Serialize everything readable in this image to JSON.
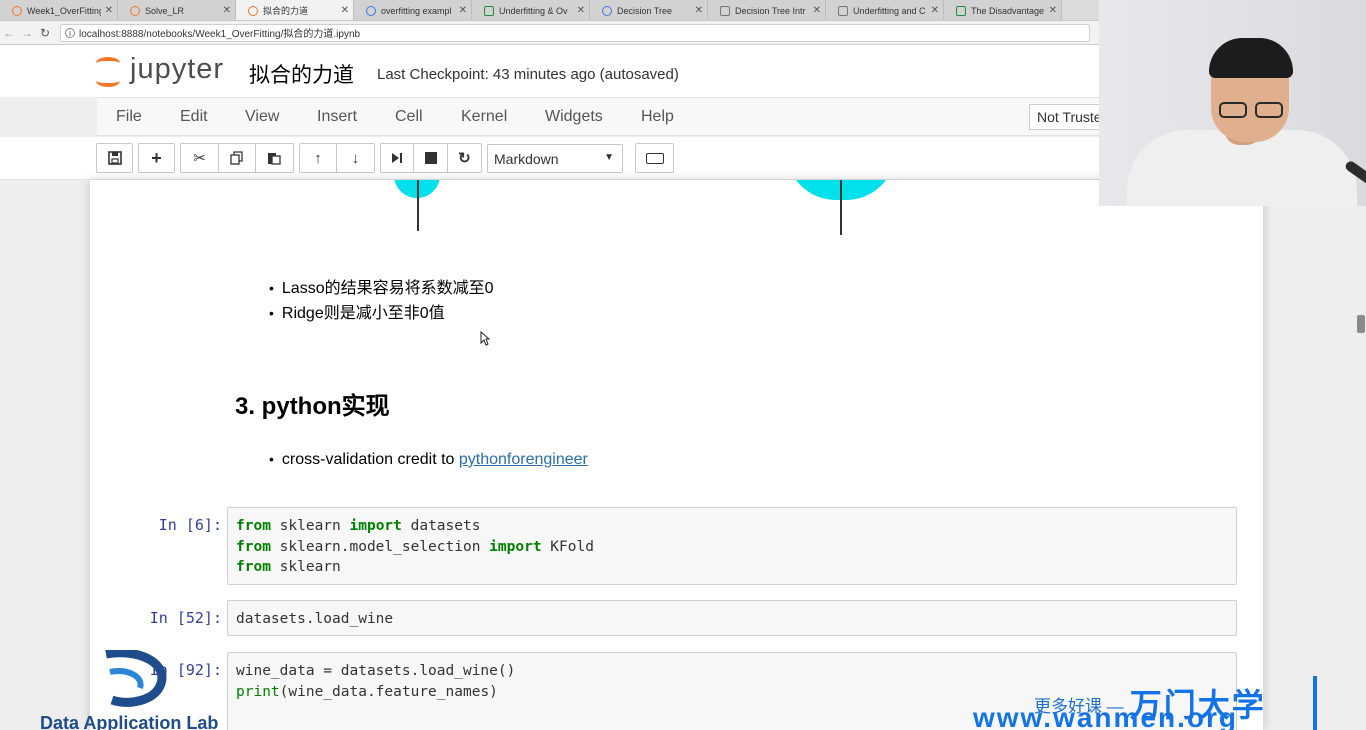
{
  "browser": {
    "tabs": [
      {
        "label": "Week1_OverFitting",
        "icon": "jupyter-icon",
        "active": false
      },
      {
        "label": "Solve_LR",
        "icon": "jupyter-icon",
        "active": false
      },
      {
        "label": "拟合的力道",
        "icon": "jupyter-icon",
        "active": true
      },
      {
        "label": "overfitting exampl",
        "icon": "globe-icon",
        "active": false
      },
      {
        "label": "Underfitting & Ov",
        "icon": "sheet-icon",
        "active": false
      },
      {
        "label": "Decision Tree",
        "icon": "book-icon",
        "active": false
      },
      {
        "label": "Decision Tree Intr",
        "icon": "doc-icon",
        "active": false
      },
      {
        "label": "Underfitting and C",
        "icon": "doc-icon",
        "active": false
      },
      {
        "label": "The Disadvantage",
        "icon": "site-icon",
        "active": false
      }
    ],
    "url": "localhost:8888/notebooks/Week1_OverFitting/拟合的力道.ipynb"
  },
  "header": {
    "app_name": "jupyter",
    "notebook_title": "拟合的力道",
    "checkpoint": "Last Checkpoint: 43 minutes ago (autosaved)"
  },
  "menu": {
    "items": [
      "File",
      "Edit",
      "View",
      "Insert",
      "Cell",
      "Kernel",
      "Widgets",
      "Help"
    ],
    "trust_label": "Not Truste"
  },
  "toolbar": {
    "cell_type": "Markdown"
  },
  "notebook": {
    "bullets1": [
      "Lasso的结果容易将系数减至0",
      "Ridge则是减小至非0值"
    ],
    "heading": "3. python实现",
    "bullet2_text": "cross-validation credit to ",
    "bullet2_link": "pythonforengineer",
    "cells": [
      {
        "prompt": "In  [6]:"
      },
      {
        "prompt": "In  [52]:"
      },
      {
        "prompt": "In  [92]:"
      }
    ]
  },
  "watermark": {
    "org_name": "Data Application Lab",
    "slogan": "更多好课 —",
    "brand": "万门大学",
    "site": "www.wanmen.org"
  },
  "colors": {
    "jupyter_orange": "#f37726",
    "keyword_green": "#008000",
    "prompt_blue": "#303f9f",
    "link_blue": "#296eaa",
    "plot_cyan": "#00e1ec",
    "watermark_blue": "#1473e6"
  }
}
